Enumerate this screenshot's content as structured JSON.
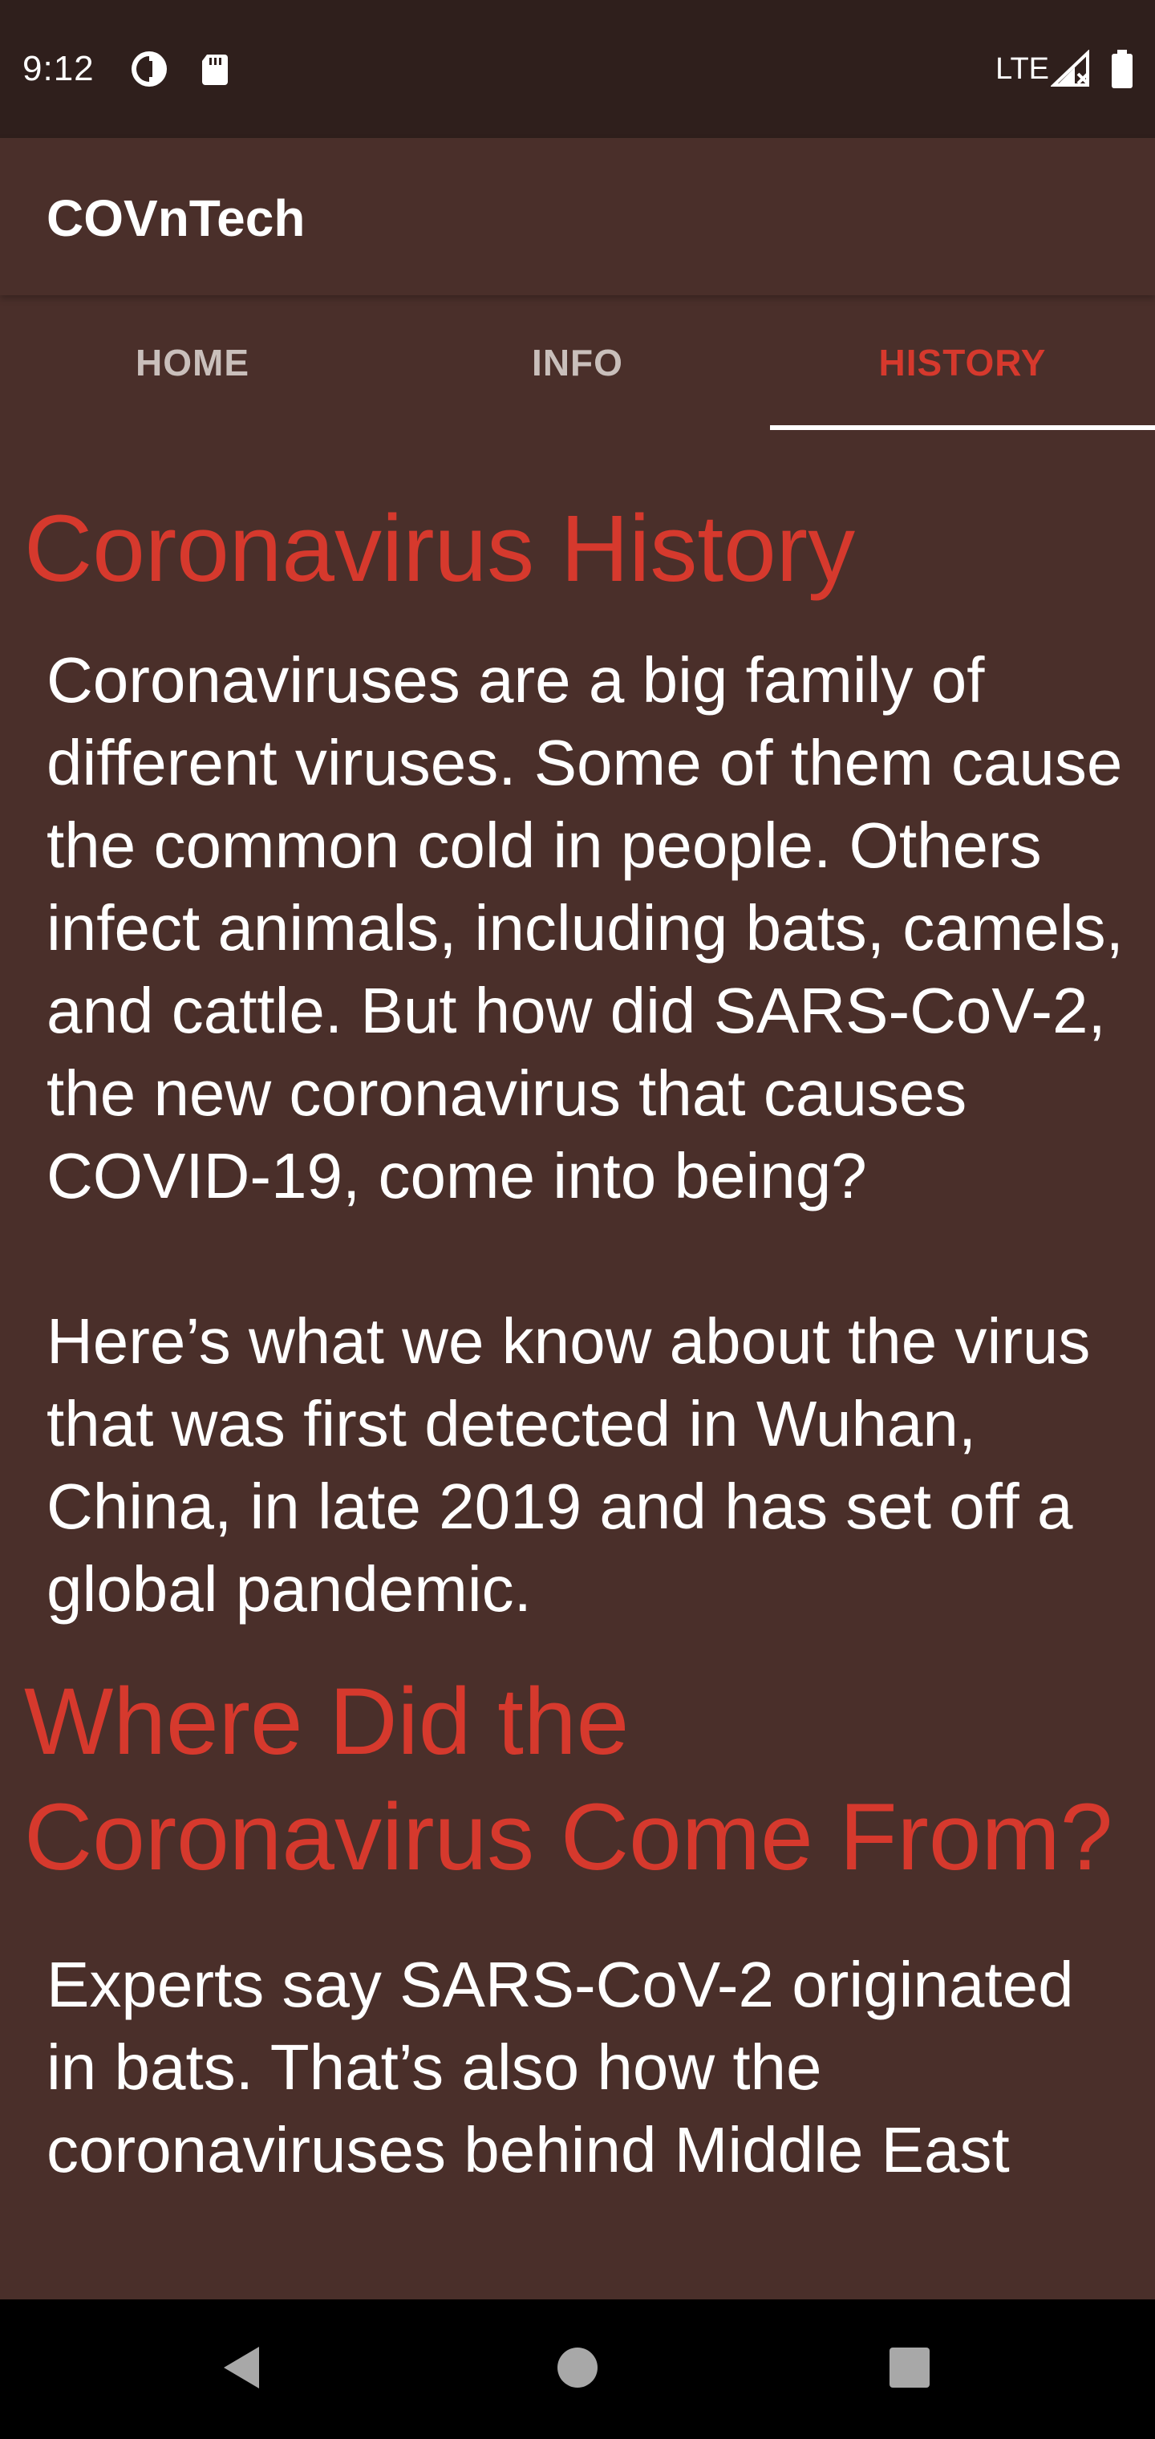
{
  "status_bar": {
    "time": "9:12",
    "network": "LTE"
  },
  "app_bar": {
    "title": "COVnTech"
  },
  "tabs": [
    {
      "label": "HOME",
      "active": false
    },
    {
      "label": "INFO",
      "active": false
    },
    {
      "label": "HISTORY",
      "active": true
    }
  ],
  "content": {
    "title": "Coronavirus History",
    "paragraph_1": "Coronaviruses are a big family of different viruses. Some of them cause the common cold in people. Others infect animals, including bats, camels, and cattle. But how did SARS-CoV-2, the new coronavirus that causes COVID-19, come into being?",
    "paragraph_2": "Here’s what we know about the virus that was first detected in Wuhan, China, in late 2019 and has set off a global pandemic.",
    "section_heading": "Where Did the\nCoronavirus Come From?",
    "paragraph_3": "Experts say SARS-CoV-2 originated in bats. That’s also how the coronaviruses behind Middle East"
  },
  "colors": {
    "status_bar_bg": "#2f1f1c",
    "background": "#4a2f2a",
    "accent": "#d6392d",
    "inactive_tab": "#c9bfbb",
    "nav_bar_bg": "#000000"
  },
  "icons": {
    "status_left": [
      "data-saver-icon",
      "sd-card-icon"
    ],
    "status_right": [
      "signal-icon",
      "battery-icon"
    ],
    "nav": [
      "back-icon",
      "home-icon",
      "recents-icon"
    ]
  }
}
